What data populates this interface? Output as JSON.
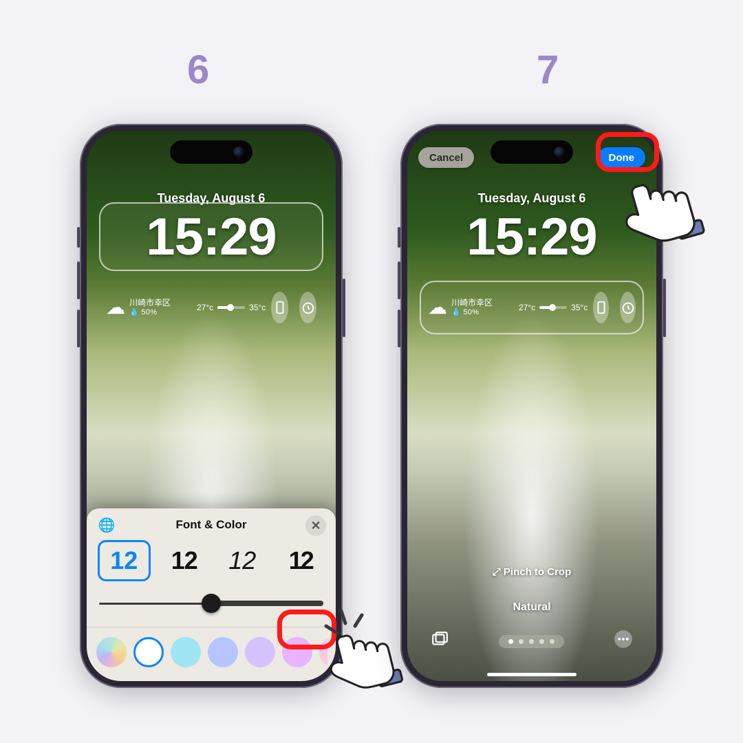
{
  "step_labels": {
    "six": "6",
    "seven": "7"
  },
  "lock": {
    "date": "Tuesday, August 6",
    "time": "15:29",
    "weather": {
      "location": "川崎市幸区",
      "humidity": "50%",
      "low": "27°c",
      "high": "35°c"
    }
  },
  "sheet": {
    "title": "Font & Color",
    "font_samples": [
      "12",
      "12",
      "12",
      "12"
    ],
    "colors": [
      "conic-gradient(from 0deg, #b7e5d6, #e9e6a4, #f5d28a, #eab7d4, #bcb7f1, #a9ddf3, #b7e5d6)",
      "#ffffff",
      "#9fe4f4",
      "#b7c5ff",
      "#d4c3ff",
      "#e9b3ff",
      "#ffc6e6"
    ]
  },
  "controls": {
    "cancel": "Cancel",
    "done": "Done",
    "pinch": "Pinch to Crop",
    "filter": "Natural"
  },
  "pager": {
    "count": 5,
    "active": 0
  }
}
